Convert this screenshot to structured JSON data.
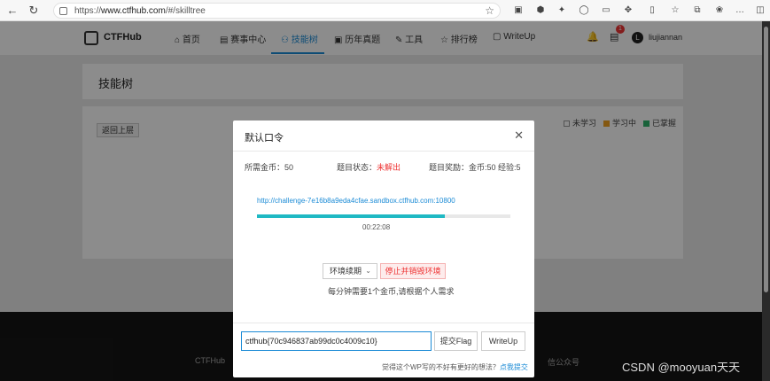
{
  "browser": {
    "url_scheme": "https://",
    "url_host": "www.ctfhub.com",
    "url_path": "/#/skilltree",
    "back_icon": "arrow-left",
    "reload_icon": "reload"
  },
  "site": {
    "logo_text": "CTFHub",
    "nav": [
      {
        "label": "⌂ 首页"
      },
      {
        "label": "▤ 赛事中心"
      },
      {
        "label": "⚇ 技能树"
      },
      {
        "label": "▣ 历年真题"
      },
      {
        "label": "✎ 工具"
      },
      {
        "label": "☆ 排行榜"
      },
      {
        "label": "▢ WriteUp"
      }
    ],
    "msg_count": "1",
    "user_initial": "L",
    "user_name": "liujiannan",
    "page_title": "技能树",
    "back_label": "返回上层",
    "legend": [
      {
        "label": "未学习",
        "color": "#ffffff"
      },
      {
        "label": "学习中",
        "color": "#f0a020"
      },
      {
        "label": "已掌握",
        "color": "#2fb36b"
      }
    ],
    "footer_left": "CTFHub",
    "footer_right": "信公众号"
  },
  "modal": {
    "title": "默认口令",
    "cost_label": "所需金币：50",
    "status_label": "题目状态：",
    "status_value": "未解出",
    "reward_label": "题目奖励：金币:50 经验:5",
    "env_url": "http://challenge-7e16b8a9eda4cfae.sandbox.ctfhub.com:10800",
    "progress": 0.74,
    "timer": "00:22:08",
    "renew_label": "环境续期",
    "stop_label": "停止并销毁环境",
    "note": "每分钟需要1个金币,请根据个人需求",
    "flag_value": "ctfhub{70c946837ab99dc0c4009c10}",
    "submit_label": "提交Flag",
    "writeup_label": "WriteUp",
    "hint_text": "觉得这个WP写的不好有更好的想法？",
    "hint_link": "点我提交"
  },
  "watermark": "CSDN @mooyuan天天"
}
